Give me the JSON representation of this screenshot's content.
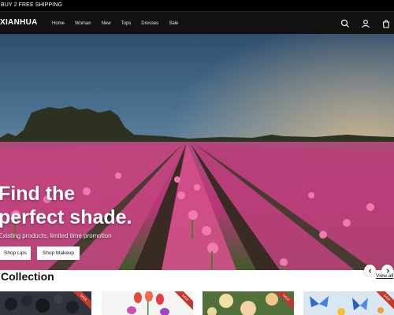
{
  "announcement": {
    "text": "BUY 2 FREE SHIPPING"
  },
  "header": {
    "logo": "XIANHUA",
    "nav": [
      "Home",
      "Woman",
      "New",
      "Tops",
      "Dresses",
      "Sale"
    ],
    "icons": [
      "search-icon",
      "account-icon",
      "cart-icon"
    ]
  },
  "hero": {
    "title_line1": "Find the",
    "title_line2": "perfect shade.",
    "subtitle": "Existing products, limited time promotion",
    "btn_lips": "Shop Lips",
    "btn_makeup": "Shop Makeup"
  },
  "collection": {
    "title": "Collection",
    "view_all": "View all",
    "cards": [
      {
        "image": "dark flowers",
        "badge": "SALE"
      },
      {
        "image": "tulips",
        "badge": "SALE"
      },
      {
        "image": "roses",
        "badge": "SALE"
      },
      {
        "image": "butterflies",
        "badge": "SALE"
      }
    ]
  },
  "colors": {
    "header_bg": "#111111",
    "badge": "#c0392b"
  }
}
